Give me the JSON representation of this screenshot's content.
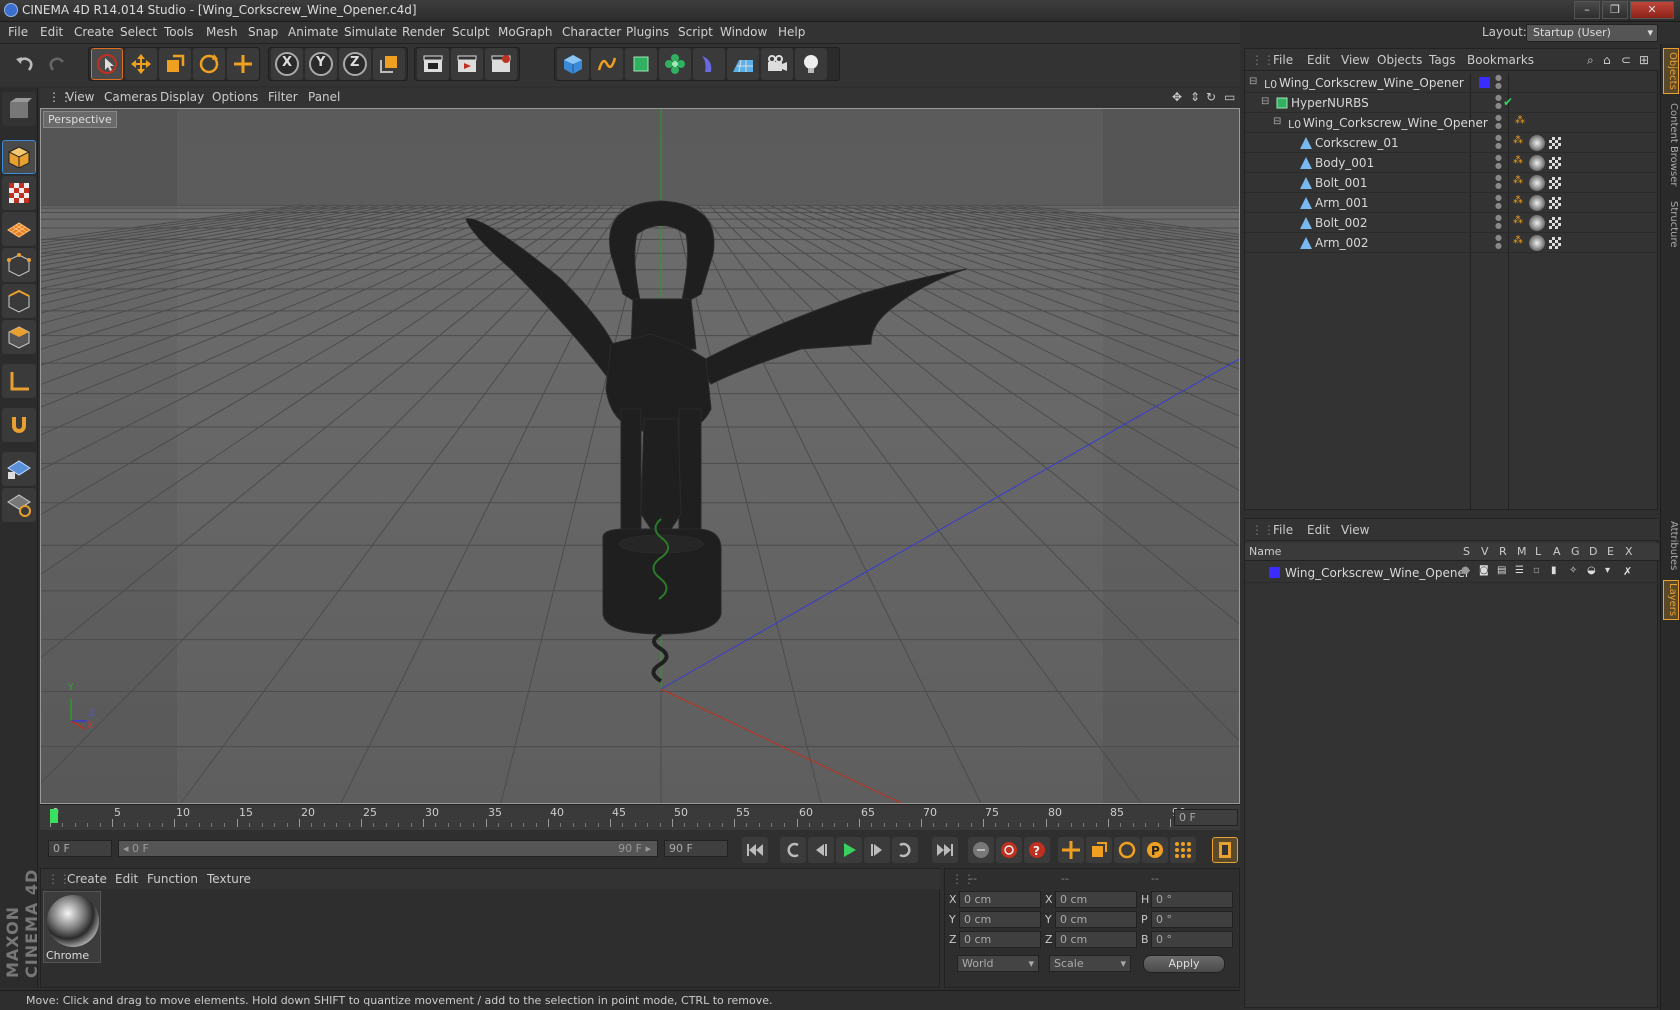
{
  "window": {
    "title": "CINEMA 4D R14.014 Studio - [Wing_Corkscrew_Wine_Opener.c4d]",
    "minimize": "–",
    "restore": "❐",
    "close": "✕"
  },
  "menubar": [
    "File",
    "Edit",
    "Create",
    "Select",
    "Tools",
    "Mesh",
    "Snap",
    "Animate",
    "Simulate",
    "Render",
    "Sculpt",
    "MoGraph",
    "Character",
    "Plugins",
    "Script",
    "Window",
    "Help"
  ],
  "layout": {
    "label": "Layout:",
    "value": "Startup (User)"
  },
  "toolbar": {
    "axis_x": "X",
    "axis_y": "Y",
    "axis_z": "Z"
  },
  "viewport": {
    "menu": [
      "View",
      "Cameras",
      "Display",
      "Options",
      "Filter",
      "Panel"
    ],
    "label": "Perspective",
    "axis_y": "Y",
    "axis_x": "X",
    "axis_z": "Z"
  },
  "timeline": {
    "ticks": [
      "0",
      "5",
      "10",
      "15",
      "20",
      "25",
      "30",
      "35",
      "40",
      "45",
      "50",
      "55",
      "60",
      "65",
      "70",
      "75",
      "80",
      "85",
      "90"
    ],
    "current_frame": "0 F"
  },
  "transport": {
    "start_field": "0 F",
    "range_start": "◂ 0 F",
    "range_end": "90 F ▸",
    "end_field": "90 F"
  },
  "material": {
    "menu": [
      "Create",
      "Edit",
      "Function",
      "Texture"
    ],
    "items": [
      {
        "name": "Chrome"
      }
    ]
  },
  "coordinates": {
    "col_headers": [
      "--",
      "--",
      "--"
    ],
    "rows": [
      {
        "a": "X",
        "a_val": "0 cm",
        "b": "X",
        "b_val": "0 cm",
        "c": "H",
        "c_val": "0 °"
      },
      {
        "a": "Y",
        "a_val": "0 cm",
        "b": "Y",
        "b_val": "0 cm",
        "c": "P",
        "c_val": "0 °"
      },
      {
        "a": "Z",
        "a_val": "0 cm",
        "b": "Z",
        "b_val": "0 cm",
        "c": "B",
        "c_val": "0 °"
      }
    ],
    "mode1": "World",
    "mode2": "Scale",
    "apply": "Apply"
  },
  "status": "Move: Click and drag to move elements. Hold down SHIFT to quantize movement / add to the selection in point mode, CTRL to remove.",
  "objects": {
    "menu": [
      "File",
      "Edit",
      "View",
      "Objects",
      "Tags",
      "Bookmarks"
    ],
    "items": [
      {
        "name": "Wing_Corkscrew_Wine_Opener",
        "indent": 0
      },
      {
        "name": "HyperNURBS",
        "indent": 1
      },
      {
        "name": "Wing_Corkscrew_Wine_Opener",
        "indent": 2
      },
      {
        "name": "Corkscrew_01",
        "indent": 3
      },
      {
        "name": "Body_001",
        "indent": 3
      },
      {
        "name": "Bolt_001",
        "indent": 3
      },
      {
        "name": "Arm_001",
        "indent": 3
      },
      {
        "name": "Bolt_002",
        "indent": 3
      },
      {
        "name": "Arm_002",
        "indent": 3
      }
    ],
    "layer_color": "#3a2cff"
  },
  "layers": {
    "menu": [
      "File",
      "Edit",
      "View"
    ],
    "header_name": "Name",
    "header_cols": [
      "S",
      "V",
      "R",
      "M",
      "L",
      "A",
      "G",
      "D",
      "E",
      "X"
    ],
    "items": [
      {
        "name": "Wing_Corkscrew_Wine_Opener",
        "color": "#3a2cff"
      }
    ]
  },
  "side_tabs": [
    "Objects",
    "Content Browser",
    "Structure",
    "Attributes",
    "Layers"
  ],
  "brand": {
    "name": "MAXON CINEMA 4D"
  }
}
